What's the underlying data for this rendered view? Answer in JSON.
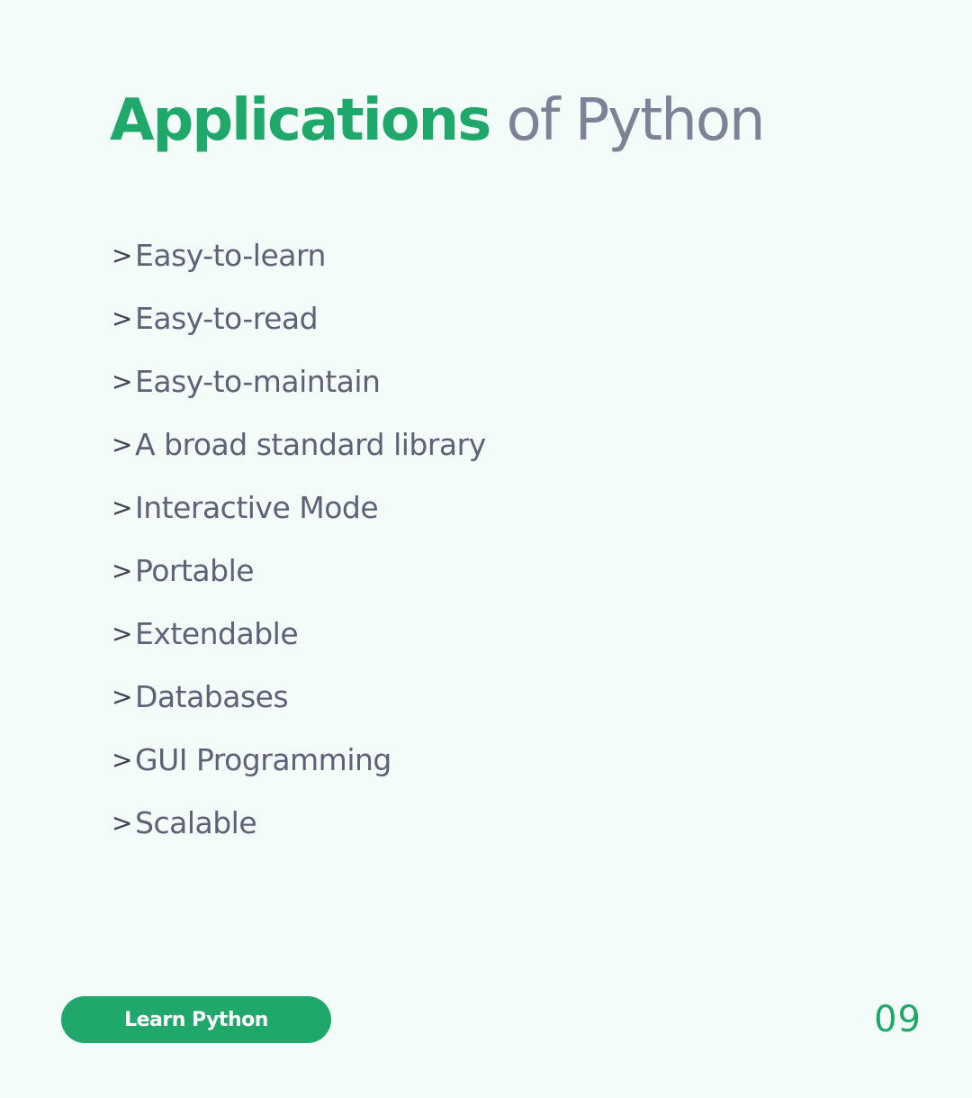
{
  "title": {
    "accent": "Applications",
    "rest": " of Python"
  },
  "features": [
    {
      "marker": ">",
      "label": "Easy-to-learn"
    },
    {
      "marker": ">",
      "label": "Easy-to-read"
    },
    {
      "marker": ">",
      "label": "Easy-to-maintain"
    },
    {
      "marker": ">",
      "label": "A broad standard library"
    },
    {
      "marker": ">",
      "label": "Interactive Mode"
    },
    {
      "marker": ">",
      "label": "Portable"
    },
    {
      "marker": ">",
      "label": "Extendable"
    },
    {
      "marker": ">",
      "label": "Databases"
    },
    {
      "marker": ">",
      "label": "GUI Programming"
    },
    {
      "marker": ">",
      "label": "Scalable"
    }
  ],
  "footer": {
    "button_label": "Learn Python",
    "page_number": "09"
  },
  "colors": {
    "background": "#f4fcf9",
    "accent": "#20a86b",
    "title_gray": "#7d8396",
    "text": "#5d6278"
  }
}
